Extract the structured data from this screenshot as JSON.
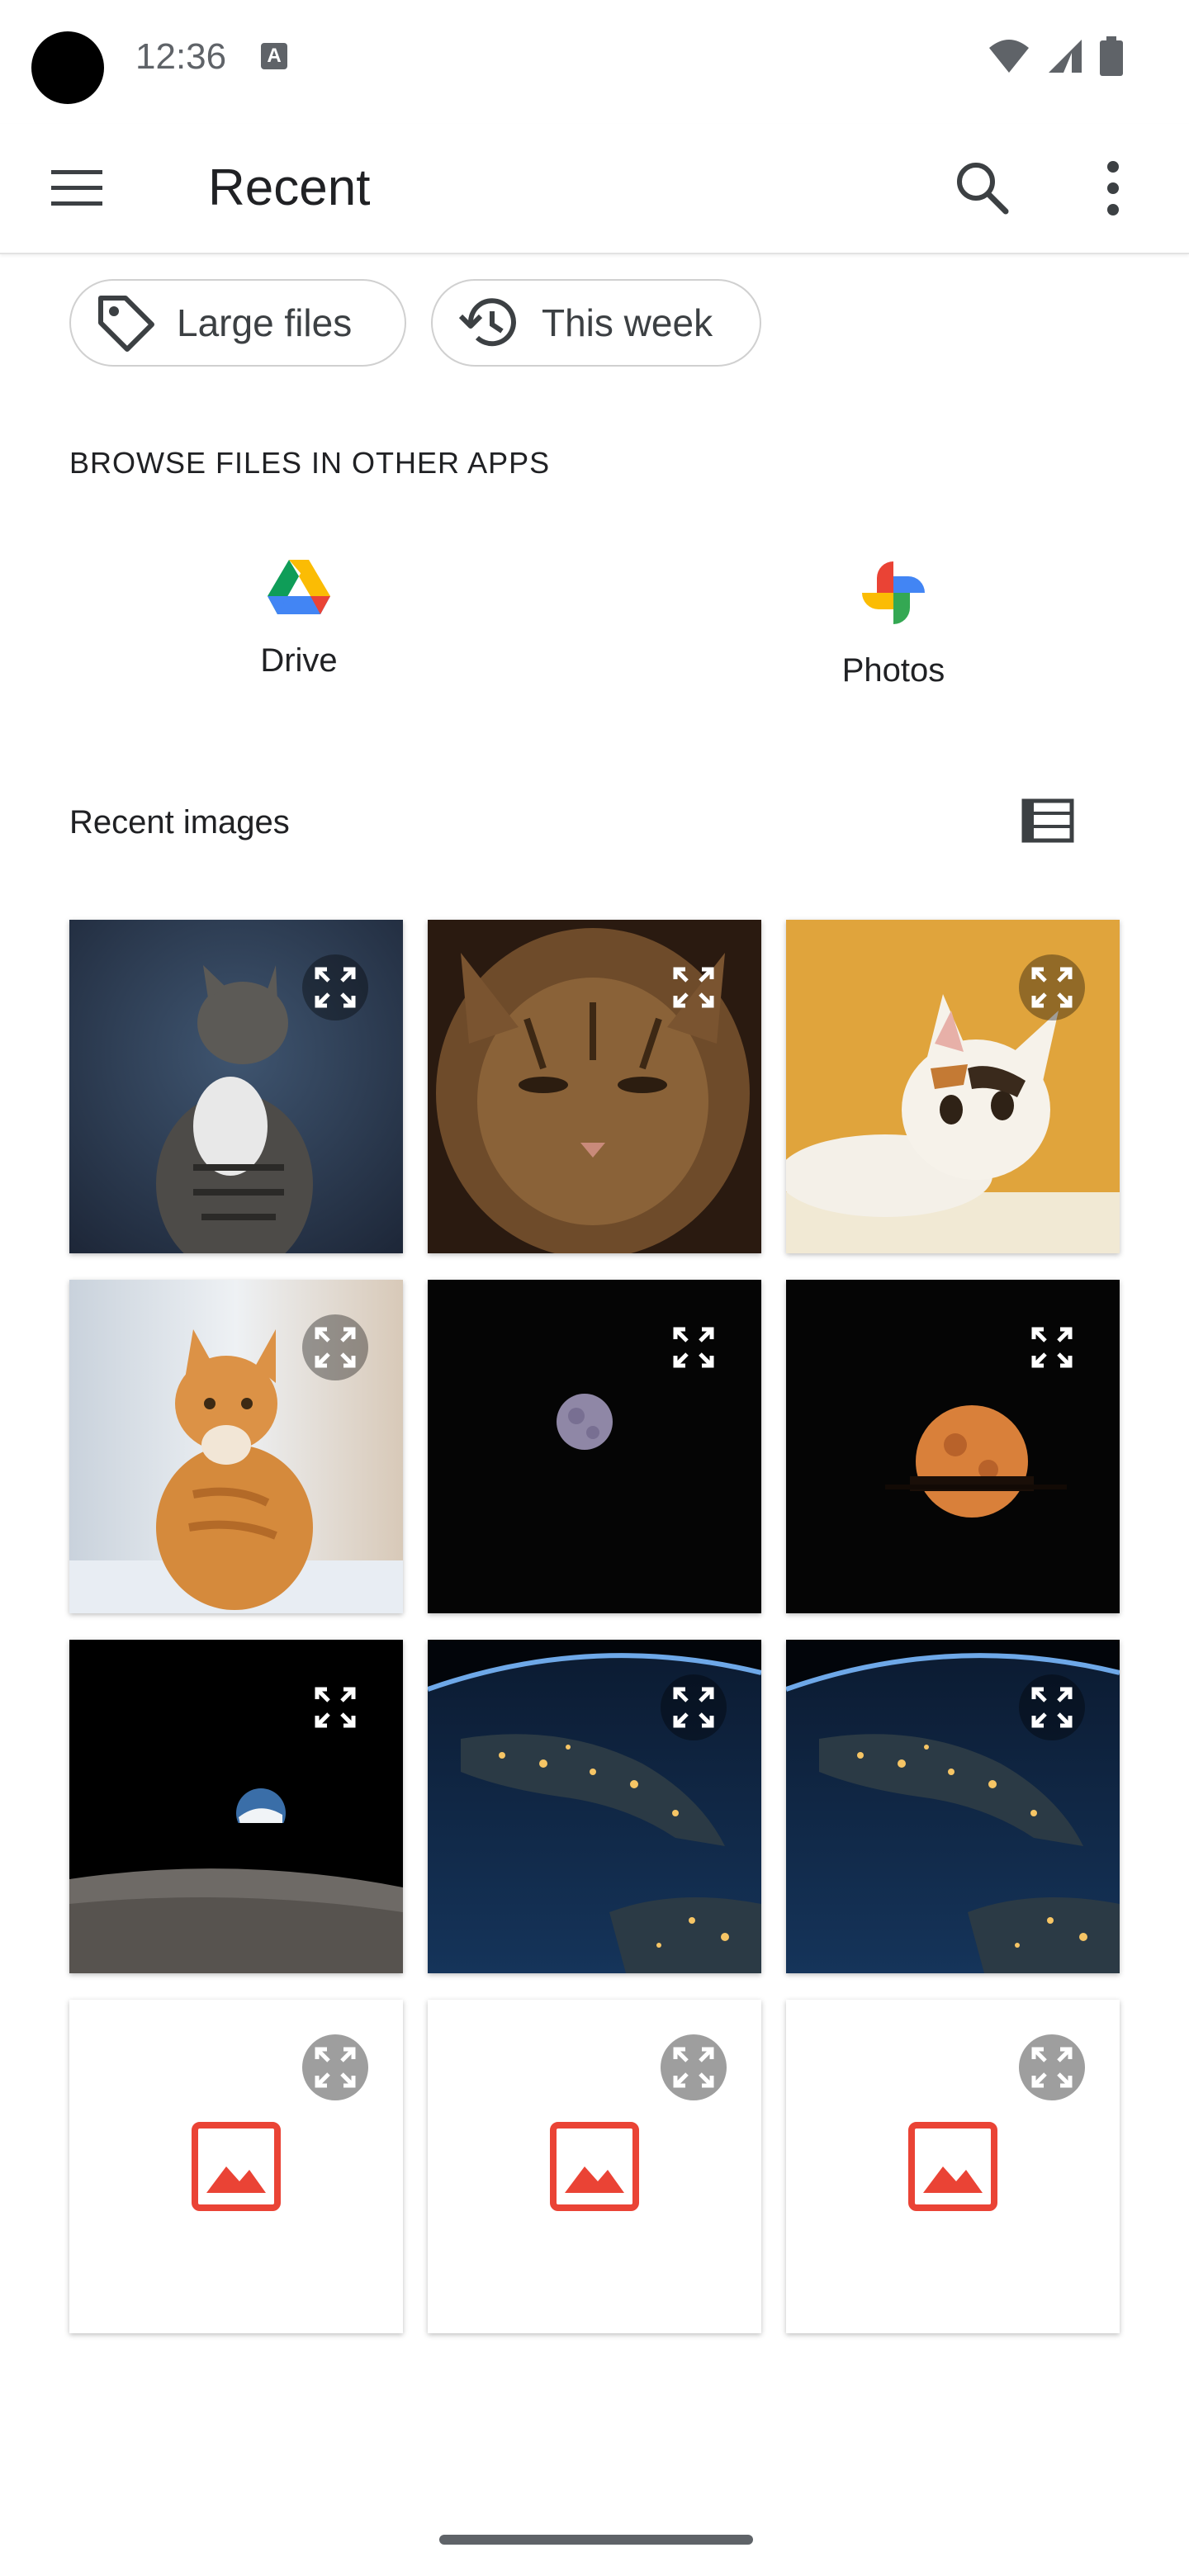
{
  "status_bar": {
    "time": "12:36",
    "notification_icon": "a-text-icon"
  },
  "app_bar": {
    "title": "Recent",
    "menu_icon": "hamburger-menu-icon",
    "search_icon": "search-icon",
    "more_icon": "more-vert-icon"
  },
  "chips": [
    {
      "label": "Large files",
      "icon": "tag-icon"
    },
    {
      "label": "This week",
      "icon": "history-icon"
    }
  ],
  "browse_section": {
    "caption": "BROWSE FILES IN OTHER APPS",
    "apps": [
      {
        "name": "Drive",
        "icon": "google-drive-icon"
      },
      {
        "name": "Photos",
        "icon": "google-photos-icon"
      }
    ]
  },
  "recent_images": {
    "title": "Recent images",
    "view_toggle_icon": "list-view-icon",
    "items": [
      {
        "subject": "tabby-cat-blue-background"
      },
      {
        "subject": "tabby-cat-closeup"
      },
      {
        "subject": "calico-kitten-yellow-background"
      },
      {
        "subject": "orange-cat-sitting"
      },
      {
        "subject": "full-moon-purple"
      },
      {
        "subject": "orange-moon"
      },
      {
        "subject": "earthrise-over-moon"
      },
      {
        "subject": "earth-at-night-from-space"
      },
      {
        "subject": "earth-at-night-from-space"
      },
      {
        "subject": "image-placeholder"
      },
      {
        "subject": "image-placeholder"
      },
      {
        "subject": "image-placeholder"
      }
    ]
  },
  "colors": {
    "accent_red": "#ea4335",
    "text": "#202124",
    "secondary": "#5f6368"
  }
}
